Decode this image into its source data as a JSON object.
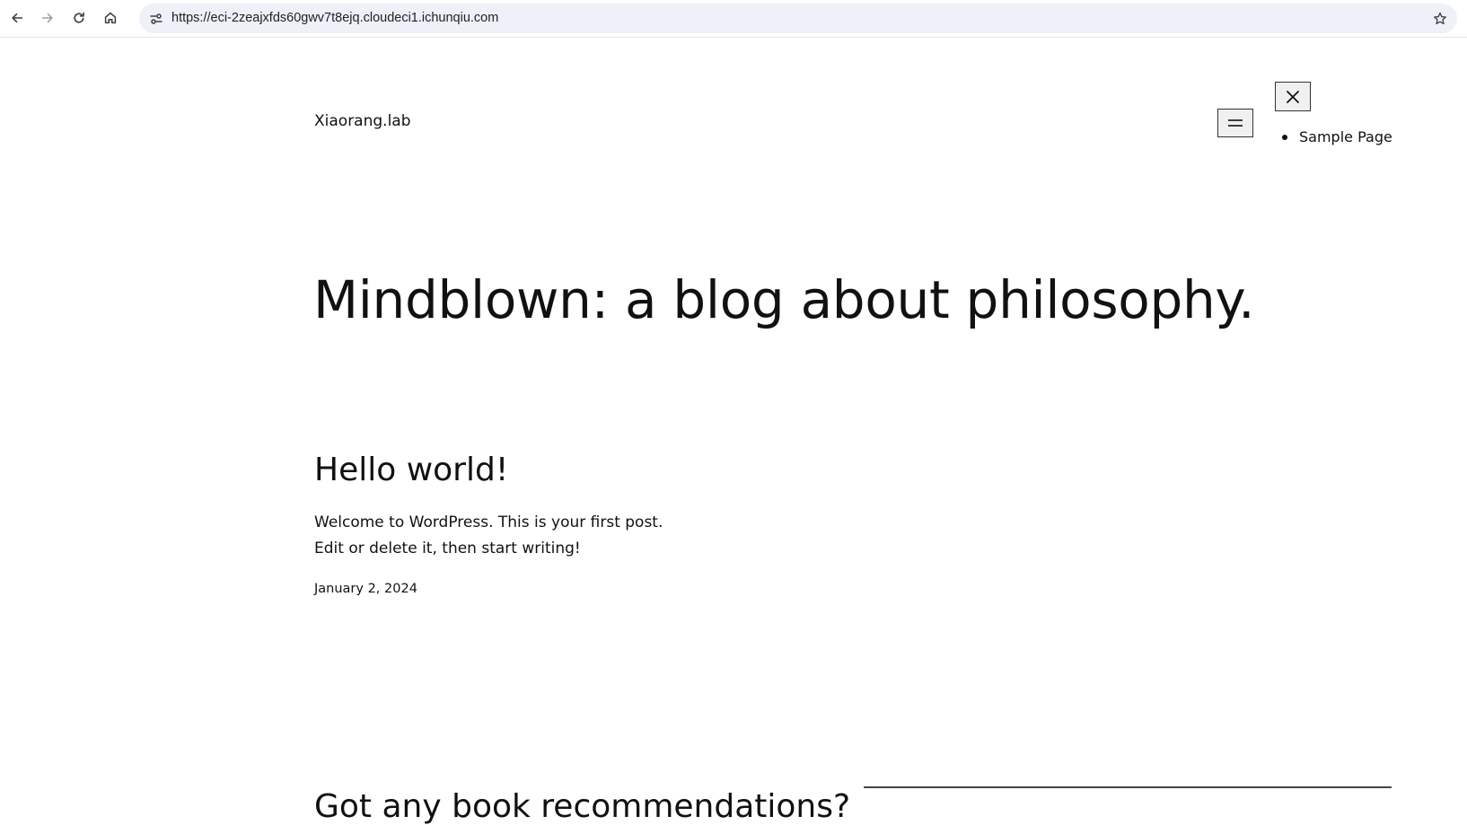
{
  "browser": {
    "url": "https://eci-2zeajxfds60gwv7t8ejq.cloudeci1.ichunqiu.com",
    "icons": [
      "back-icon",
      "forward-icon",
      "reload-icon",
      "home-icon",
      "site-info-icon",
      "bookmark-star-icon"
    ]
  },
  "header": {
    "site_title": "Xiaorang.lab",
    "nav_items": [
      {
        "label": "Sample Page"
      }
    ],
    "icons": [
      "hamburger-menu-icon",
      "close-icon"
    ]
  },
  "hero": {
    "title": "Mindblown: a blog about philosophy."
  },
  "posts": [
    {
      "title": "Hello world!",
      "excerpt": "Welcome to WordPress. This is your first post. Edit or delete it, then start writing!",
      "date": "January 2, 2024"
    }
  ],
  "footer_cta": {
    "heading": "Got any book recommendations?"
  },
  "colors": {
    "page_background": "#ffffff",
    "text": "#111111",
    "omnibox_background": "#eef1f8"
  }
}
